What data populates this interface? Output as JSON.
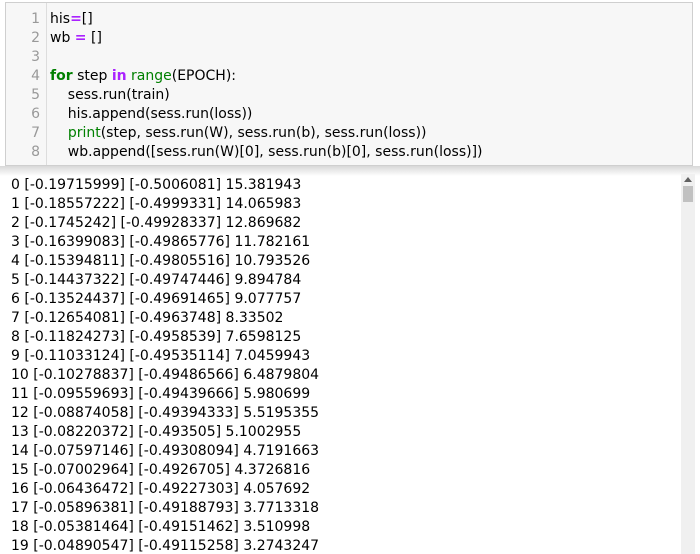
{
  "code_cell": {
    "lines": [
      {
        "num": "1",
        "tokens": [
          {
            "t": "his",
            "c": ""
          },
          {
            "t": "=",
            "c": "op"
          },
          {
            "t": "[]",
            "c": ""
          }
        ]
      },
      {
        "num": "2",
        "tokens": [
          {
            "t": "wb ",
            "c": ""
          },
          {
            "t": "=",
            "c": "op"
          },
          {
            "t": " []",
            "c": ""
          }
        ]
      },
      {
        "num": "3",
        "tokens": []
      },
      {
        "num": "4",
        "tokens": [
          {
            "t": "for",
            "c": "kw"
          },
          {
            "t": " step ",
            "c": ""
          },
          {
            "t": "in",
            "c": "op"
          },
          {
            "t": " ",
            "c": ""
          },
          {
            "t": "range",
            "c": "bi"
          },
          {
            "t": "(EPOCH):",
            "c": ""
          }
        ]
      },
      {
        "num": "5",
        "tokens": [
          {
            "t": "    sess.run(train)",
            "c": ""
          }
        ]
      },
      {
        "num": "6",
        "tokens": [
          {
            "t": "    his.append(sess.run(loss))",
            "c": ""
          }
        ]
      },
      {
        "num": "7",
        "tokens": [
          {
            "t": "    ",
            "c": ""
          },
          {
            "t": "print",
            "c": "bi"
          },
          {
            "t": "(step, sess.run(W), sess.run(b), sess.run(loss))",
            "c": ""
          }
        ]
      },
      {
        "num": "8",
        "tokens": [
          {
            "t": "    wb.append([sess.run(W)[0], sess.run(b)[0], sess.run(loss)])",
            "c": ""
          }
        ]
      }
    ]
  },
  "output_lines": [
    "0 [-0.19715999] [-0.5006081] 15.381943",
    "1 [-0.18557222] [-0.4999331] 14.065983",
    "2 [-0.1745242] [-0.49928337] 12.869682",
    "3 [-0.16399083] [-0.49865776] 11.782161",
    "4 [-0.15394811] [-0.49805516] 10.793526",
    "5 [-0.14437322] [-0.49747446] 9.894784",
    "6 [-0.13524437] [-0.49691465] 9.077757",
    "7 [-0.12654081] [-0.4963748] 8.33502",
    "8 [-0.11824273] [-0.4958539] 7.6598125",
    "9 [-0.11033124] [-0.49535114] 7.0459943",
    "10 [-0.10278837] [-0.49486566] 6.4879804",
    "11 [-0.09559693] [-0.49439666] 5.980699",
    "12 [-0.08874058] [-0.49394333] 5.5195355",
    "13 [-0.08220372] [-0.493505] 5.1002955",
    "14 [-0.07597146] [-0.49308094] 4.7191663",
    "15 [-0.07002964] [-0.4926705] 4.3726816",
    "16 [-0.06436472] [-0.49227303] 4.057692",
    "17 [-0.05896381] [-0.49188793] 3.7713318",
    "18 [-0.05381464] [-0.49151462] 3.510998",
    "19 [-0.04890547] [-0.49115258] 3.2743247"
  ]
}
